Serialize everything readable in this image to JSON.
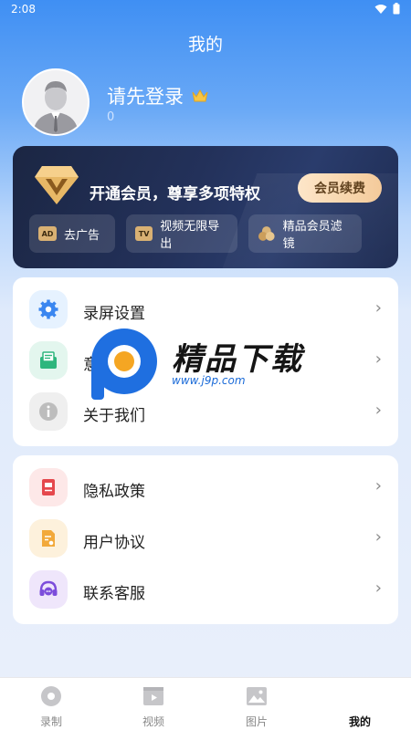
{
  "status_bar": {
    "time": "2:08"
  },
  "header": {
    "title": "我的"
  },
  "profile": {
    "login_prompt": "请先登录",
    "count": "0"
  },
  "vip": {
    "title": "开通会员，尊享多项特权",
    "renew_label": "会员续费",
    "perks": [
      {
        "label": "去广告",
        "badge": "AD"
      },
      {
        "label": "视频无限导出",
        "badge": "TV"
      },
      {
        "label": "精品会员滤镜"
      }
    ]
  },
  "menu_group_1": [
    {
      "label": "录屏设置",
      "icon": "gear-icon"
    },
    {
      "label": "意见反馈",
      "icon": "feedback-icon"
    },
    {
      "label": "关于我们",
      "icon": "info-icon"
    }
  ],
  "menu_group_2": [
    {
      "label": "隐私政策",
      "icon": "document-icon"
    },
    {
      "label": "用户协议",
      "icon": "agreement-icon"
    },
    {
      "label": "联系客服",
      "icon": "headset-icon"
    }
  ],
  "watermark": {
    "text": "精品下载",
    "url": "www.j9p.com"
  },
  "bottom_nav": {
    "tabs": [
      {
        "label": "录制",
        "icon": "record-icon"
      },
      {
        "label": "视频",
        "icon": "video-icon"
      },
      {
        "label": "图片",
        "icon": "image-icon"
      },
      {
        "label": "我的",
        "active": true
      }
    ]
  },
  "colors": {
    "primary_blue": "#3f8ff3",
    "vip_gold": "#f4c896",
    "vip_dark": "#1b2643"
  }
}
